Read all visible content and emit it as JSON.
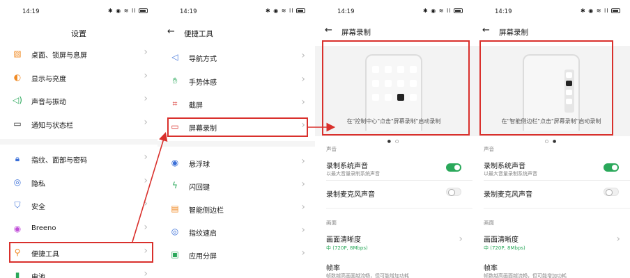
{
  "status": {
    "time": "14:19",
    "icons": "✱ ◉ ≋ ll"
  },
  "screen1": {
    "title": "设置",
    "items": [
      {
        "label": "桌面、锁屏与息屏"
      },
      {
        "label": "显示与亮度"
      },
      {
        "label": "声音与振动"
      },
      {
        "label": "通知与状态栏"
      },
      {
        "label": "指纹、面部与密码"
      },
      {
        "label": "隐私"
      },
      {
        "label": "安全"
      },
      {
        "label": "Breeno"
      },
      {
        "label": "便捷工具"
      },
      {
        "label": "电池"
      }
    ]
  },
  "screen2": {
    "title": "便捷工具",
    "items": [
      {
        "label": "导航方式"
      },
      {
        "label": "手势体感"
      },
      {
        "label": "截屏"
      },
      {
        "label": "屏幕录制"
      },
      {
        "label": "悬浮球"
      },
      {
        "label": "闪回键"
      },
      {
        "label": "智能侧边栏"
      },
      {
        "label": "指纹速启"
      },
      {
        "label": "应用分屏"
      }
    ]
  },
  "screen3": {
    "title": "屏幕录制",
    "caption": "在\"控制中心\"点击\"屏幕录制\"启动录制",
    "pager": "● ○",
    "sound_section": "声音",
    "sys_sound": "录制系统声音",
    "sys_sound_desc": "以最大音量录制系统声音",
    "mic_sound": "录制麦克风声音",
    "picture_section": "画面",
    "clarity": "画面清晰度",
    "clarity_value": "中 (720P, 8Mbps)",
    "frame_rate": "帧率",
    "frame_rate_desc": "帧数越高画面越流畅，但可能增加功耗"
  },
  "screen4": {
    "title": "屏幕录制",
    "caption": "在\"智能侧边栏\"点击\"屏幕录制\"启动录制",
    "pager": "○ ●",
    "sound_section": "声音",
    "sys_sound": "录制系统声音",
    "sys_sound_desc": "以最大音量录制系统声音",
    "mic_sound": "录制麦克风声音",
    "picture_section": "画面",
    "clarity": "画面清晰度",
    "clarity_value": "中 (720P, 8Mbps)",
    "frame_rate": "帧率",
    "frame_rate_desc": "帧数越高画面越流畅，但可能增加功耗"
  }
}
